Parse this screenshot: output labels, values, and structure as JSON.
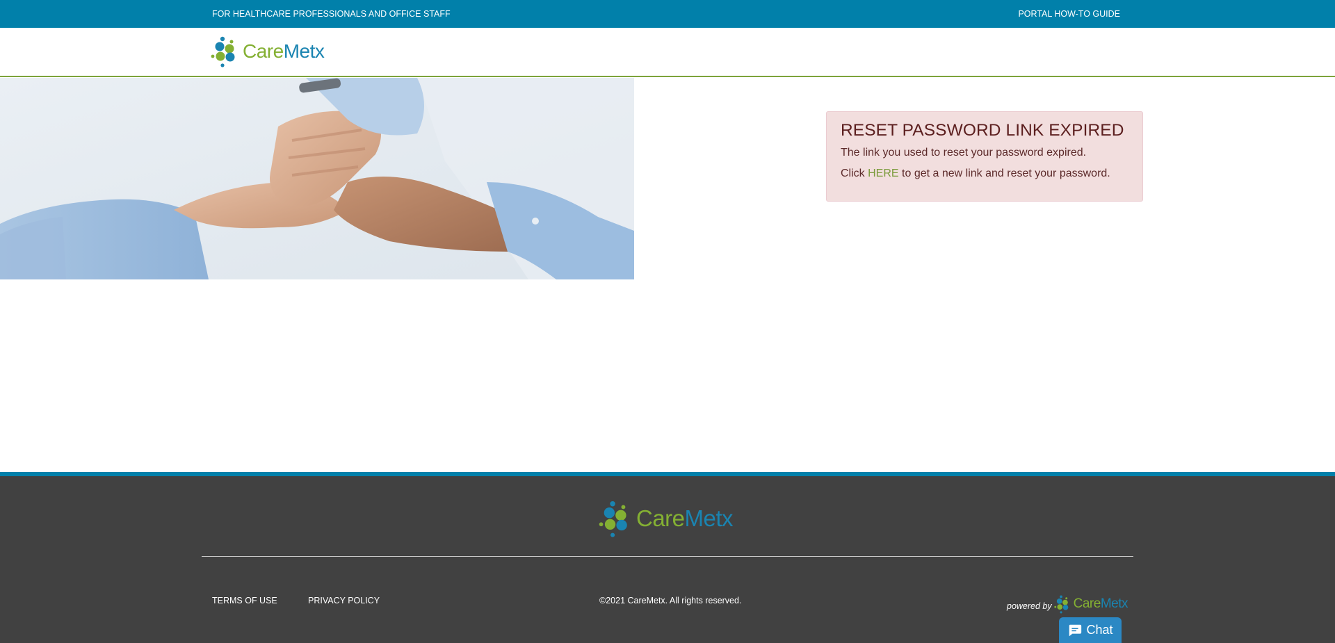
{
  "topbar": {
    "audience": "FOR HEALTHCARE PROFESSIONALS AND OFFICE STAFF",
    "guide_link": "PORTAL HOW-TO GUIDE",
    "color": "#0180aa"
  },
  "brand": {
    "care": "Care",
    "metx": "Metx",
    "green": "#84b033",
    "blue": "#1a84b1"
  },
  "alert": {
    "title": "RESET PASSWORD LINK EXPIRED",
    "message": "The link you used to reset your password expired.",
    "click": "Click",
    "here_link": "HERE",
    "suffix": "to get a new link and reset your password.",
    "background": "#f2dede"
  },
  "footer": {
    "terms": "TERMS OF USE",
    "privacy": "PRIVACY POLICY",
    "copyright": "©2021 CareMetx. All rights reserved.",
    "powered_by": "powered by",
    "background": "#414141"
  },
  "chat": {
    "label": "Chat",
    "icon": "chat-bubble-icon"
  },
  "hero": {
    "image": "hands-holding-image"
  }
}
